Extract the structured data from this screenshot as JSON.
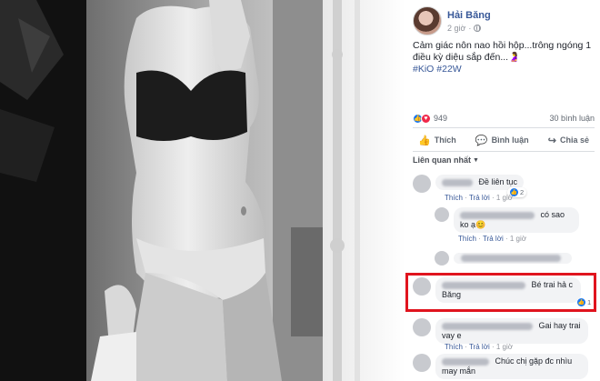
{
  "post": {
    "author": "Hải Băng",
    "time": "2 giờ",
    "text": "Cảm giác nôn nao hồi hộp...trông ngóng 1 điều kỳ diệu sắp đến...🤰",
    "hashtags": [
      "#KiO",
      "#22W"
    ],
    "reaction_count": "949",
    "comment_count": "30 bình luận"
  },
  "actions": {
    "like": "Thích",
    "comment": "Bình luận",
    "share": "Chia sẻ"
  },
  "relevance_label": "Liên quan nhất",
  "comments": [
    {
      "text": "Đề liên tục",
      "like": "Thích",
      "reply": "Trả lời",
      "time": "1 giờ",
      "reactions": "2"
    },
    {
      "text": "có sao ko ạ😊",
      "like": "Thích",
      "reply": "Trả lời",
      "time": "1 giờ"
    },
    {
      "text": "Bé trai hả c Băng",
      "reactions": "1"
    },
    {
      "text": "Gai hay trai vay e",
      "like": "Thích",
      "reply": "Trả lời",
      "time": "1 giờ"
    },
    {
      "text": "Chúc chị gặp đc nhìu may mắn"
    }
  ],
  "icons": {
    "globe": "globe-icon",
    "like": "thumbs-up-icon",
    "comment": "comment-icon",
    "share": "share-icon",
    "heart": "heart-icon"
  },
  "colors": {
    "link": "#385898",
    "highlight": "#e0141e",
    "like_blue": "#1877f2"
  }
}
